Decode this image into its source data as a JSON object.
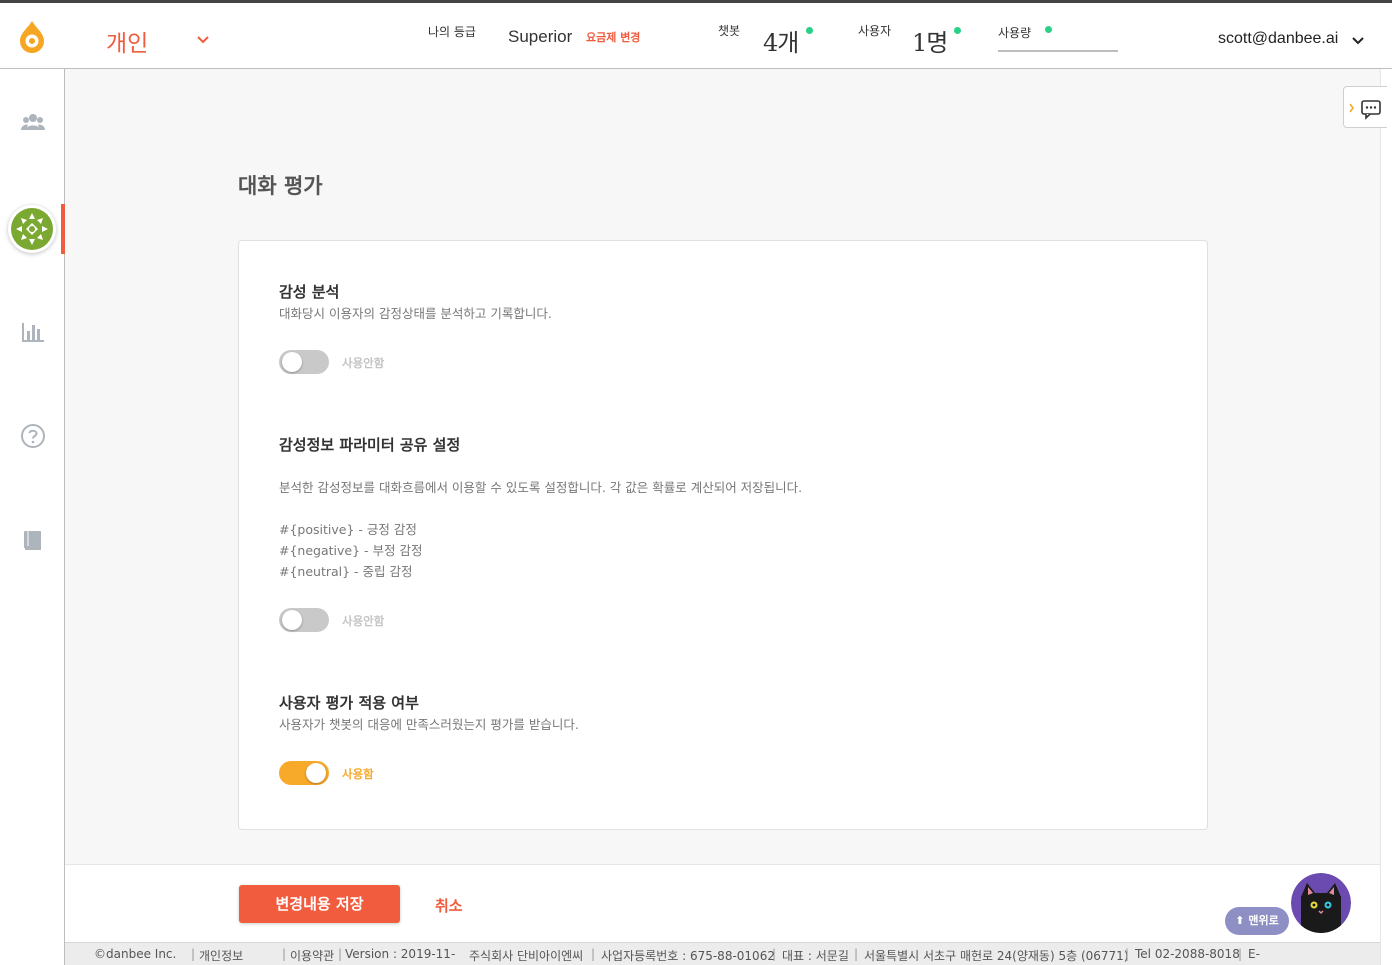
{
  "header": {
    "workspace": "개인",
    "grade_label": "나의 등급",
    "grade_value": "Superior",
    "change_plan": "요금제 변경",
    "chatbot_label": "챗봇",
    "chatbot_count": "4개",
    "users_label": "사용자",
    "users_count": "1명",
    "usage_label": "사용량",
    "user_email": "scott@danbee.ai",
    "status_color": "#29d186",
    "accent_color": "#f15c3f"
  },
  "sidebar": {
    "items": [
      {
        "icon": "users-icon",
        "active": false
      },
      {
        "icon": "chatbot-avatar-icon",
        "active": true
      },
      {
        "icon": "bar-chart-icon",
        "active": false
      },
      {
        "icon": "help-icon",
        "active": false
      },
      {
        "icon": "book-icon",
        "active": false
      }
    ]
  },
  "page": {
    "title": "대화 평가"
  },
  "sections": {
    "sentiment": {
      "title": "감성 분석",
      "description": "대화당시 이용자의 감정상태를 분석하고 기록합니다.",
      "enabled": false,
      "toggle_label": "사용안함"
    },
    "sentiment_params": {
      "title": "감성정보 파라미터 공유 설정",
      "description": "분석한 감성정보를 대화흐름에서 이용할 수 있도록 설정합니다. 각 값은 확률로 계산되어 저장됩니다.",
      "param_positive": "#{positive} - 긍정 감정",
      "param_negative": "#{negative} - 부정 감정",
      "param_neutral": "#{neutral} - 중립 감정",
      "enabled": false,
      "toggle_label": "사용안함"
    },
    "user_rating": {
      "title": "사용자 평가 적용 여부",
      "description": "사용자가 챗봇의 대응에 만족스러웠는지 평가를 받습니다.",
      "enabled": true,
      "toggle_label": "사용함"
    }
  },
  "actions": {
    "save": "변경내용 저장",
    "cancel": "취소",
    "to_top": "⬆ 맨위로"
  },
  "footer": {
    "copyright": "©danbee Inc.",
    "privacy": "개인정보",
    "terms": "이용약관",
    "version": "Version : 2019-11-",
    "company": "주식회사 단비아이엔씨",
    "biz_no": "사업자등록번호 : 675-88-01062",
    "ceo": "대표 : 서문길",
    "address": "서울특별시 서초구 매헌로 24(양재동) 5층 (06771)",
    "tel": "Tel 02-2088-8018",
    "email_prefix": "E-"
  }
}
